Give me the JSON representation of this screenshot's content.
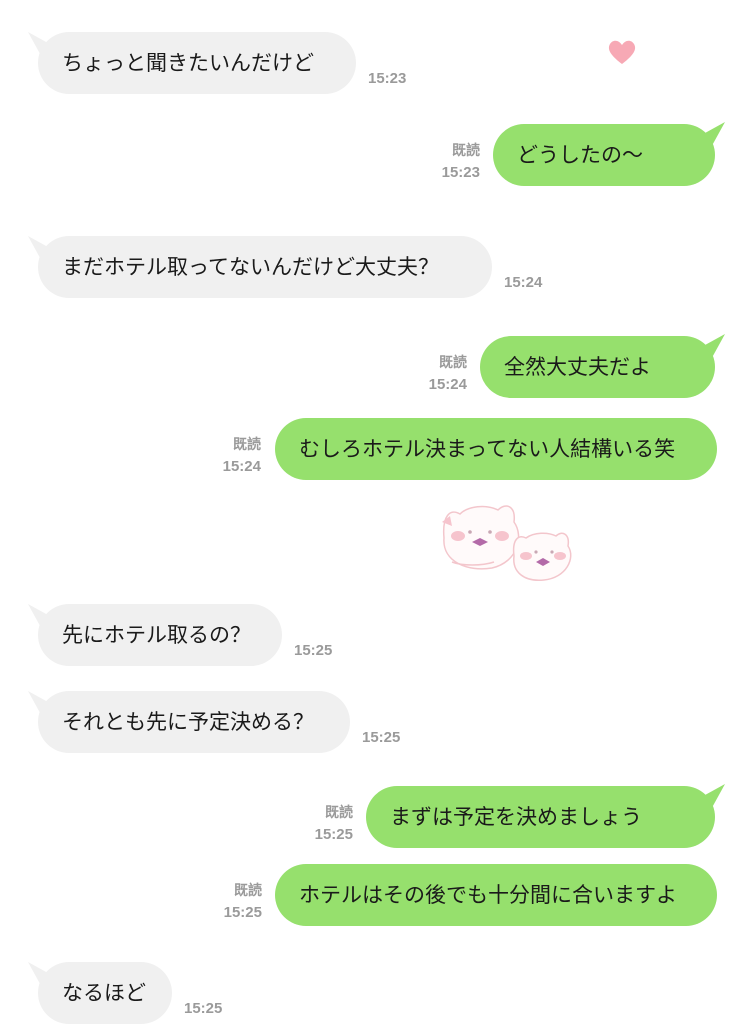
{
  "messages": [
    {
      "side": "in",
      "text": "ちょっと聞きたいんだけど",
      "time": "15:23"
    },
    {
      "side": "out",
      "text": "どうしたの〜",
      "read": "既読",
      "time": "15:23"
    },
    {
      "side": "in",
      "text": "まだホテル取ってないんだけど大丈夫？",
      "time": "15:24"
    },
    {
      "side": "out",
      "text": "全然大丈夫だよ",
      "read": "既読",
      "time": "15:24"
    },
    {
      "side": "out",
      "text": "むしろホテル決まってない人結構いる笑",
      "read": "既読",
      "time": "15:24"
    },
    {
      "side": "in",
      "text": "先にホテル取るの？",
      "time": "15:25"
    },
    {
      "side": "in",
      "text": "それとも先に予定決める？",
      "time": "15:25"
    },
    {
      "side": "out",
      "text": "まずは予定を決めましょう",
      "read": "既読",
      "time": "15:25"
    },
    {
      "side": "out",
      "text": "ホテルはその後でも十分間に合いますよ",
      "read": "既読",
      "time": "15:25"
    },
    {
      "side": "in",
      "text": "なるほど",
      "time": "15:25"
    }
  ],
  "stickers": {
    "heart": "heart-icon",
    "cats": "cat-faces-sticker"
  },
  "colors": {
    "outgoing": "#96e06d",
    "incoming": "#f0f0f0",
    "meta": "#9a9a9a",
    "heart": "#f7a9b5"
  }
}
